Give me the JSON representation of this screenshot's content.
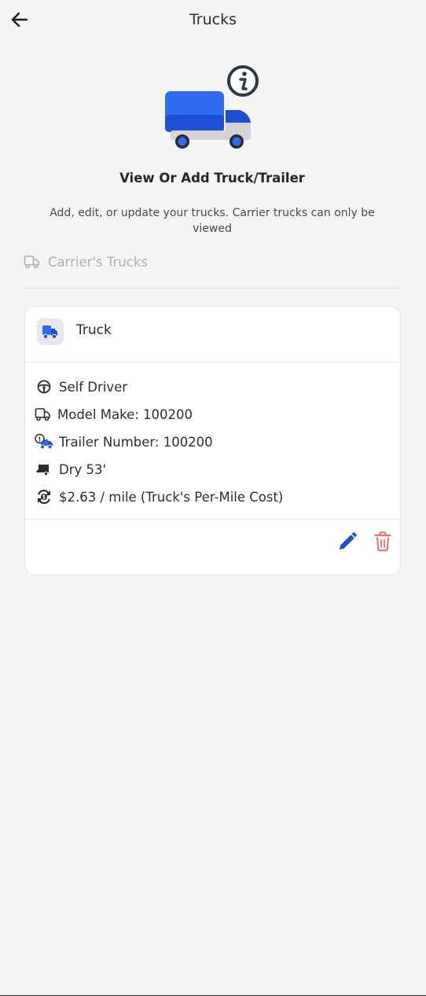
{
  "header": {
    "title": "Trucks",
    "back_icon": "arrow-left-icon"
  },
  "hero": {
    "illustration": "truck-info-illustration",
    "title": "View Or Add Truck/Trailer",
    "description": "Add, edit, or update your trucks. Carrier trucks can only be viewed"
  },
  "carrier": {
    "label": "Carrier's Trucks",
    "icon": "truck-outline-icon"
  },
  "card": {
    "title": "Truck",
    "rows": [
      {
        "icon": "steering-wheel-icon",
        "text": "Self Driver"
      },
      {
        "icon": "truck-outline-icon",
        "text": "Model Make: 100200"
      },
      {
        "icon": "trailer-info-icon",
        "text": "Trailer Number: 100200"
      },
      {
        "icon": "trailer-icon",
        "text": "Dry  53'"
      },
      {
        "icon": "cost-cycle-icon",
        "text": "$2.63 / mile (Truck's Per-Mile Cost)"
      }
    ],
    "actions": {
      "edit_icon": "pencil-icon",
      "delete_icon": "trash-icon"
    }
  },
  "colors": {
    "accent": "#2563eb",
    "accent_dark": "#1d4ed8",
    "danger": "#ef6b6b",
    "background": "#f4f4f5"
  }
}
